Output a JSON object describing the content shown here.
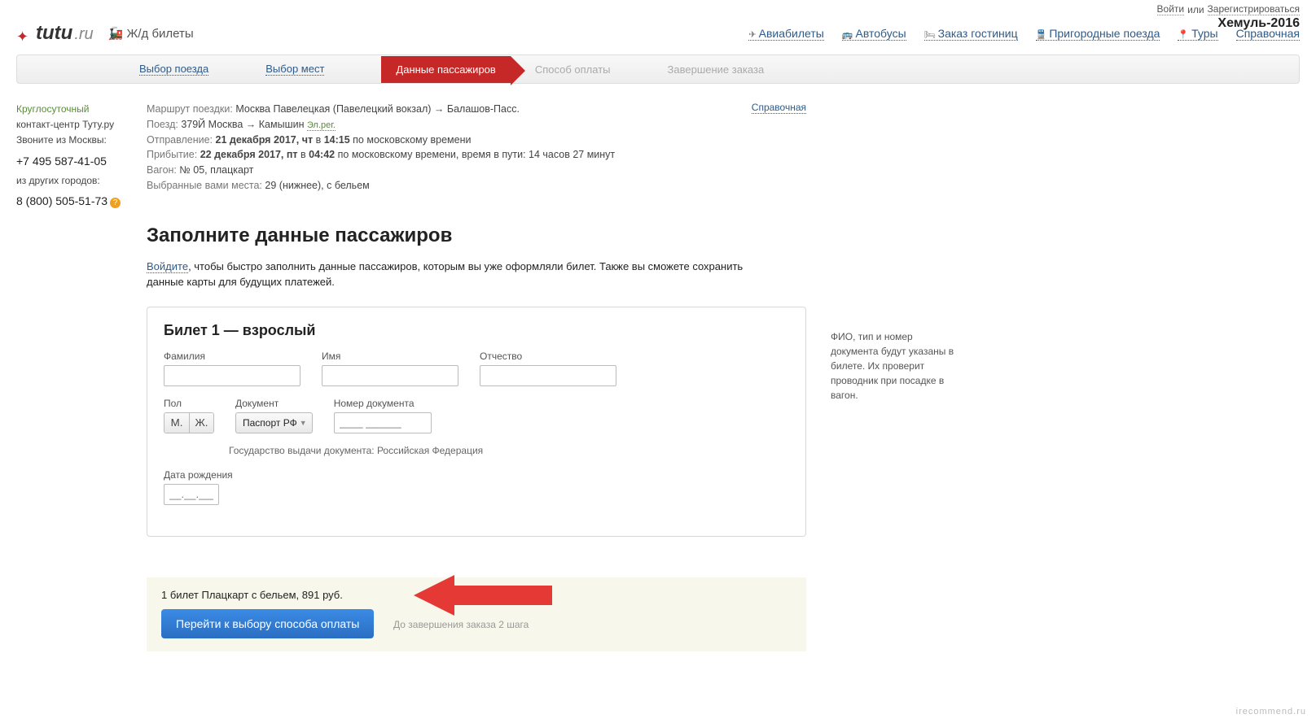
{
  "top": {
    "login": "Войти",
    "or": "или",
    "register": "Зарегистрироваться"
  },
  "annotation": "Хемуль-2016",
  "logo": {
    "tutu": "tutu",
    "ru": ".ru"
  },
  "section": "Ж/д билеты",
  "nav": {
    "avia": "Авиабилеты",
    "bus": "Автобусы",
    "hotel": "Заказ гостиниц",
    "suburban": "Пригородные поезда",
    "tours": "Туры",
    "help": "Справочная"
  },
  "steps": {
    "s1": "Выбор поезда",
    "s2": "Выбор мест",
    "s3": "Данные пассажиров",
    "s4": "Способ оплаты",
    "s5": "Завершение заказа"
  },
  "sidebar": {
    "green": "Круглосуточный",
    "center": "контакт-центр Туту.ру",
    "from_moscow": "Звоните из Москвы:",
    "phone1": "+7 495 587-41-05",
    "other": "из других городов:",
    "phone2": "8 (800) 505-51-73"
  },
  "help_link": "Справочная",
  "trip": {
    "route_lbl": "Маршрут поездки:",
    "route_val": "Москва Павелецкая (Павелецкий вокзал) → Балашов-Пасс.",
    "train_lbl": "Поезд:",
    "train_val": "379Й Москва → Камышин",
    "ereg": "Эл.рег.",
    "dep_lbl": "Отправление:",
    "dep_bold": "21 декабря 2017, чт",
    "dep_in": "в",
    "dep_time": "14:15",
    "dep_tail": "по московскому времени",
    "arr_lbl": "Прибытие:",
    "arr_bold": "22 декабря 2017, пт",
    "arr_in": "в",
    "arr_time": "04:42",
    "arr_tail": "по московскому времени, время в пути: 14 часов 27 минут",
    "wagon_lbl": "Вагон:",
    "wagon_val": "№ 05, плацкарт",
    "seats_lbl": "Выбранные вами места:",
    "seats_val": "29 (нижнее), с бельем"
  },
  "heading": "Заполните данные пассажиров",
  "login_hint": {
    "link": "Войдите",
    "text": ", чтобы быстро заполнить данные пассажиров, которым вы уже оформляли билет. Также вы сможете сохранить данные карты для будущих платежей."
  },
  "ticket": {
    "title": "Билет 1 — взрослый",
    "lastname": "Фамилия",
    "firstname": "Имя",
    "patronym": "Отчество",
    "gender": "Пол",
    "gender_m": "М.",
    "gender_f": "Ж.",
    "doc": "Документ",
    "doc_val": "Паспорт РФ",
    "doc_num": "Номер документа",
    "doc_placeholder": "____ ______",
    "issuer": "Государство выдачи документа: Российская Федерация",
    "dob": "Дата рождения",
    "dob_placeholder": "__.__.____"
  },
  "aside_tip": "ФИО, тип и номер документа будут указаны в билете. Их проверит проводник при посадке в вагон.",
  "checkout": {
    "summary": "1 билет Плацкарт с бельем, 891 руб.",
    "button": "Перейти к выбору способа оплаты",
    "remain": "До завершения заказа 2 шага"
  },
  "watermark": "irecommend.ru"
}
